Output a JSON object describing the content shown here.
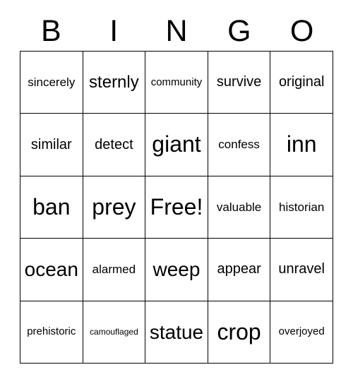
{
  "card": {
    "title": "BINGO",
    "header_letters": [
      "B",
      "I",
      "N",
      "G",
      "O"
    ],
    "free_space_label": "Free!",
    "colors": {
      "background": "#ffffff",
      "text": "#000000",
      "grid_line": "#000000"
    },
    "grid": {
      "rows": 5,
      "columns": 5,
      "cells": [
        [
          {
            "text": "sincerely",
            "size": "sm"
          },
          {
            "text": "sternly",
            "size": "lg"
          },
          {
            "text": "community",
            "size": "xs"
          },
          {
            "text": "survive",
            "size": "md"
          },
          {
            "text": "original",
            "size": "md"
          }
        ],
        [
          {
            "text": "similar",
            "size": "md"
          },
          {
            "text": "detect",
            "size": "md"
          },
          {
            "text": "giant",
            "size": "xxl"
          },
          {
            "text": "confess",
            "size": "sm"
          },
          {
            "text": "inn",
            "size": "xxl"
          }
        ],
        [
          {
            "text": "ban",
            "size": "xxl"
          },
          {
            "text": "prey",
            "size": "xxl"
          },
          {
            "text": "Free!",
            "size": "xxl"
          },
          {
            "text": "valuable",
            "size": "sm"
          },
          {
            "text": "historian",
            "size": "sm"
          }
        ],
        [
          {
            "text": "ocean",
            "size": "xl"
          },
          {
            "text": "alarmed",
            "size": "sm"
          },
          {
            "text": "weep",
            "size": "xl"
          },
          {
            "text": "appear",
            "size": "md"
          },
          {
            "text": "unravel",
            "size": "md"
          }
        ],
        [
          {
            "text": "prehistoric",
            "size": "xs"
          },
          {
            "text": "camouflaged",
            "size": "xxs"
          },
          {
            "text": "statue",
            "size": "xl"
          },
          {
            "text": "crop",
            "size": "xxl"
          },
          {
            "text": "overjoyed",
            "size": "xs"
          }
        ]
      ]
    }
  }
}
